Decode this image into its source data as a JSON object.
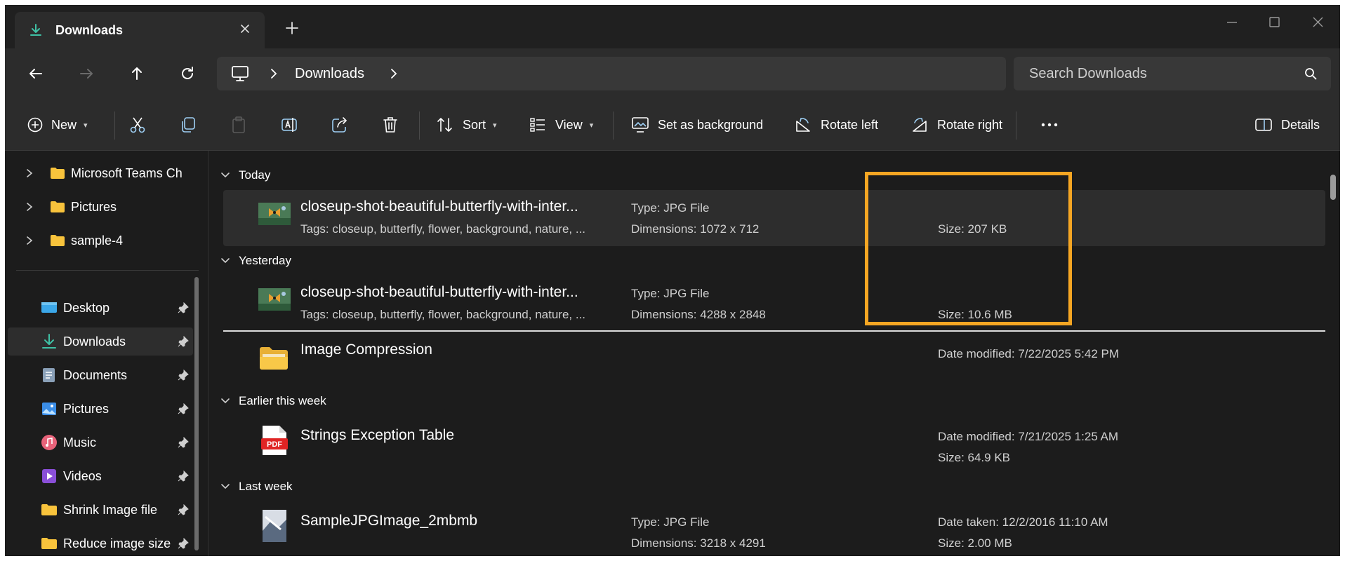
{
  "window": {
    "tab_title": "Downloads",
    "tab_icon": "download-icon"
  },
  "nav": {
    "address_location": "Downloads",
    "search_placeholder": "Search Downloads"
  },
  "toolbar": {
    "new_label": "New",
    "sort_label": "Sort",
    "view_label": "View",
    "set_background_label": "Set as background",
    "rotate_left_label": "Rotate left",
    "rotate_right_label": "Rotate right",
    "details_label": "Details"
  },
  "sidebar": {
    "tree": [
      {
        "label": "Microsoft Teams Cha"
      },
      {
        "label": "Pictures"
      },
      {
        "label": "sample-4"
      }
    ],
    "quick_access": [
      {
        "label": "Desktop",
        "icon": "desktop-icon"
      },
      {
        "label": "Downloads",
        "icon": "download-icon",
        "active": true
      },
      {
        "label": "Documents",
        "icon": "documents-icon"
      },
      {
        "label": "Pictures",
        "icon": "pictures-icon"
      },
      {
        "label": "Music",
        "icon": "music-icon"
      },
      {
        "label": "Videos",
        "icon": "videos-icon"
      },
      {
        "label": "Shrink Image file",
        "icon": "folder-icon"
      },
      {
        "label": "Reduce image size i",
        "icon": "folder-icon"
      }
    ]
  },
  "groups": {
    "today": "Today",
    "yesterday": "Yesterday",
    "earlier": "Earlier this week",
    "last_week": "Last week"
  },
  "files": [
    {
      "name": "closeup-shot-beautiful-butterfly-with-inter...",
      "tags": "Tags: closeup, butterfly, flower, background, nature, ...",
      "type": "Type: JPG File",
      "dimensions": "Dimensions: 1072 x 712",
      "size": "Size: 207 KB"
    },
    {
      "name": "closeup-shot-beautiful-butterfly-with-inter...",
      "tags": "Tags: closeup, butterfly, flower, background, nature, ...",
      "type": "Type: JPG File",
      "dimensions": "Dimensions: 4288 x 2848",
      "size": "Size: 10.6 MB"
    },
    {
      "name": "Image Compression",
      "date": "Date modified: 7/22/2025 5:42 PM"
    },
    {
      "name": "Strings Exception Table",
      "date": "Date modified: 7/21/2025 1:25 AM",
      "size": "Size: 64.9 KB"
    },
    {
      "name": "SampleJPGImage_2mbmb",
      "type": "Type: JPG File",
      "dimensions": "Dimensions: 3218 x 4291",
      "date": "Date taken: 12/2/2016 11:10 AM",
      "size": "Size: 2.00 MB"
    }
  ],
  "colors": {
    "highlight": "#f5a623",
    "accent": "#3fc1a5"
  }
}
